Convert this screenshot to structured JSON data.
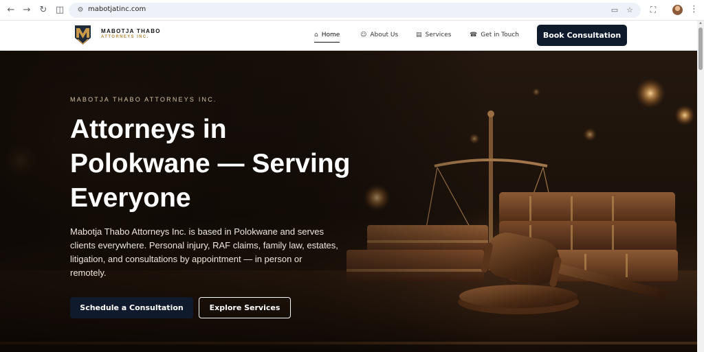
{
  "browser": {
    "url": "mabotjatinc.com",
    "icons": {
      "back": "arrow-left-icon",
      "forward": "arrow-right-icon",
      "reload": "reload-icon",
      "reading_mode": "reading-mode-icon",
      "site_info": "site-info-icon",
      "install": "install-app-icon",
      "bookmark": "star-icon",
      "extensions": "puzzle-icon",
      "menu": "kebab-menu-icon"
    }
  },
  "header": {
    "logo_line1": "MABOTJA THABO",
    "logo_line2": "ATTORNEYS INC.",
    "nav": [
      {
        "label": "Home",
        "icon": "home-icon",
        "active": true
      },
      {
        "label": "About Us",
        "icon": "people-icon",
        "active": false
      },
      {
        "label": "Services",
        "icon": "briefcase-icon",
        "active": false
      },
      {
        "label": "Get in Touch",
        "icon": "phone-icon",
        "active": false
      }
    ],
    "cta": "Book Consultation"
  },
  "hero": {
    "eyebrow": "MABOTJA THABO ATTORNEYS INC.",
    "headline_line1": "Attorneys in",
    "headline_line2": "Polokwane — Serving",
    "headline_line3": "Everyone",
    "lede": "Mabotja Thabo Attorneys Inc. is based in Polokwane and serves clients everywhere. Personal injury, RAF claims, family law, estates, litigation, and consultations by appointment — in person or remotely.",
    "primary_button": "Schedule a Consultation",
    "secondary_button": "Explore Services"
  },
  "colors": {
    "brand_navy": "#0f1b2d",
    "brand_gold": "#b7893e",
    "hero_text": "#ffffff"
  }
}
